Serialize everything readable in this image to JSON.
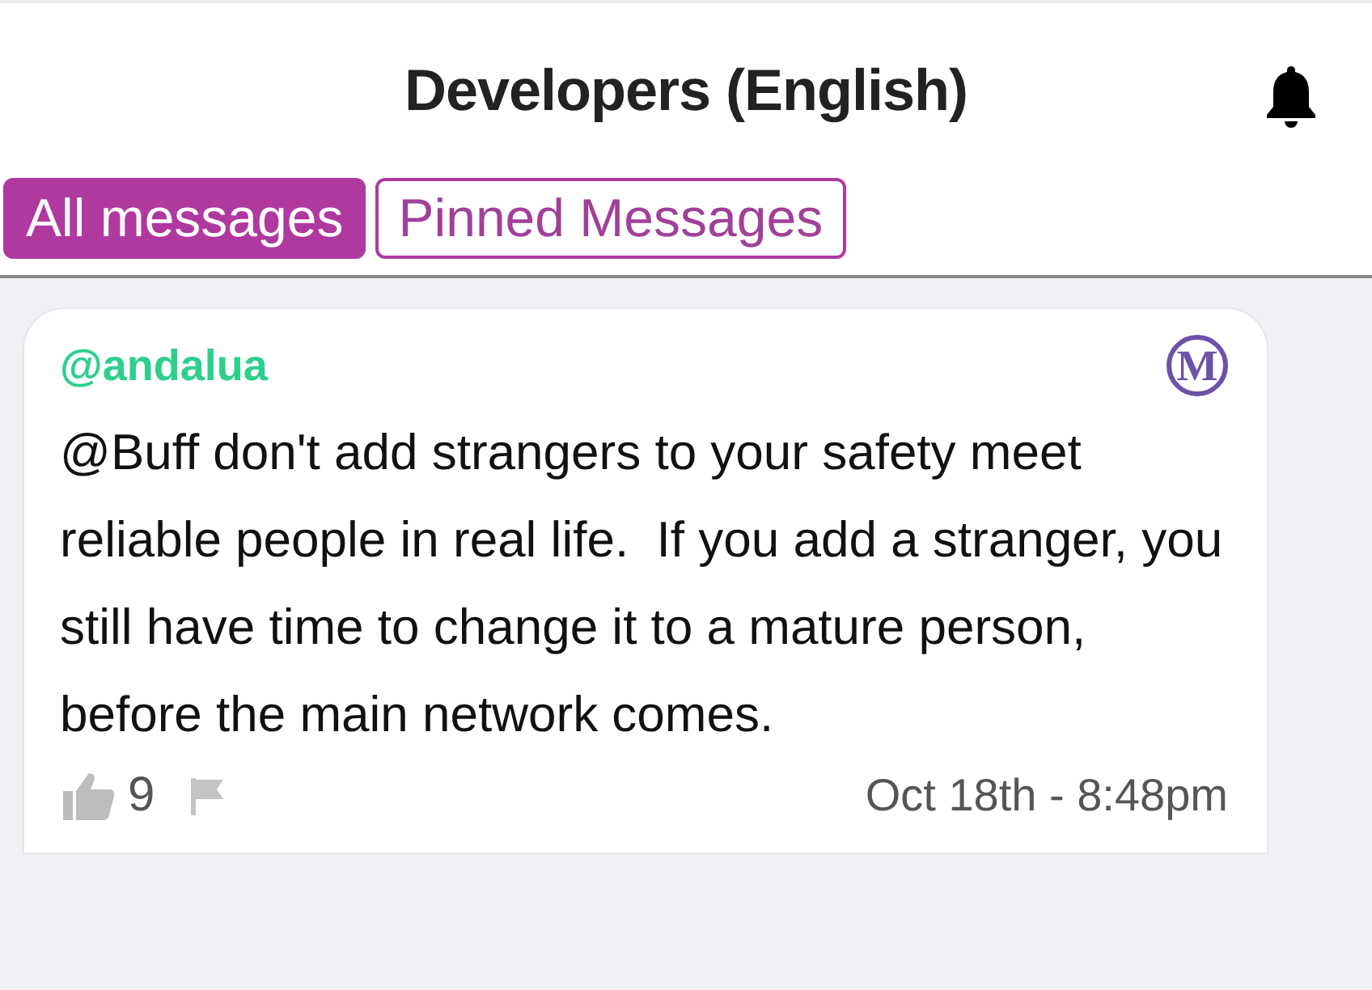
{
  "header": {
    "title": "Developers (English)"
  },
  "tabs": [
    {
      "label": "All messages",
      "selected": true
    },
    {
      "label": "Pinned Messages",
      "selected": false
    }
  ],
  "messages": [
    {
      "author": "@andalua",
      "badge": "M",
      "text": "@Buff don't add strangers to your safety meet reliable people in real life.  If you add a stranger, you still have time to change it to a mature person, before the main network comes.",
      "likes": "9",
      "time": "Oct 18th - 8:48pm"
    }
  ]
}
